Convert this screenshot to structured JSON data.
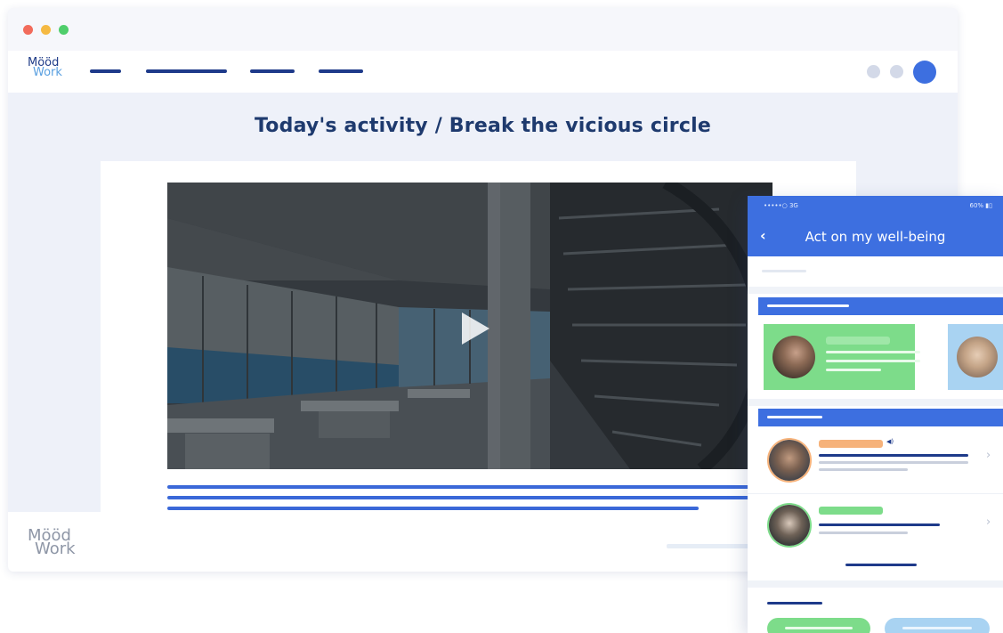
{
  "colors": {
    "accent": "#3d6fe0",
    "navy": "#1e3a8a",
    "title": "#1e3a6e",
    "green_card": "#7ddc8a",
    "light_blue_card": "#a9d3f2",
    "orange_pill": "#f6b27a",
    "traffic_red": "#f26b5b",
    "traffic_yellow": "#f5b942",
    "traffic_green": "#4fce6b"
  },
  "icons": {
    "close": "red-dot-icon",
    "minimize": "yellow-dot-icon",
    "maximize": "green-dot-icon",
    "play": "play-icon",
    "back": "chevron-left-icon",
    "speaker": "speaker-icon",
    "next": "chevron-right-icon"
  },
  "brand": {
    "line1": "Mööd",
    "line2": "Work"
  },
  "page": {
    "title": "Today's activity / Break the vicious circle"
  },
  "phone": {
    "status_left": "•••••○ 3G",
    "status_right": "60% ▮▯",
    "back_glyph": "‹",
    "title": "Act on my well-being",
    "chevron": "›",
    "speaker_glyph": "◀)"
  }
}
